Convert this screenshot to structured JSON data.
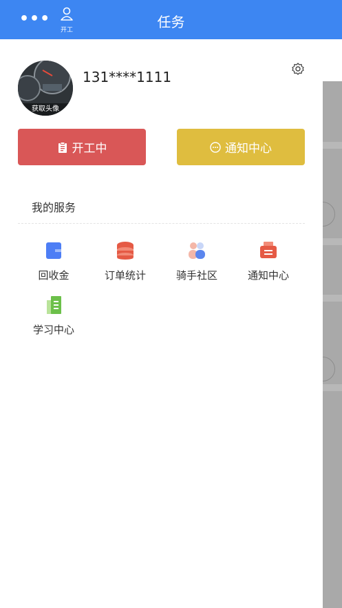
{
  "header": {
    "more_label": "•••",
    "work_label": "开工",
    "title": "任务"
  },
  "profile": {
    "avatar_caption": "获取头像",
    "phone": "131****1111"
  },
  "actions": {
    "work_button": "开工中",
    "notice_button": "通知中心"
  },
  "services": {
    "title": "我的服务",
    "items": [
      {
        "label": "回收金",
        "icon": "wallet-icon"
      },
      {
        "label": "订单统计",
        "icon": "database-icon"
      },
      {
        "label": "骑手社区",
        "icon": "community-icon"
      },
      {
        "label": "通知中心",
        "icon": "printer-icon"
      },
      {
        "label": "学习中心",
        "icon": "book-icon"
      }
    ]
  },
  "colors": {
    "header": "#3d86f2",
    "work_button": "#d95757",
    "notice_button": "#dfbd3f"
  }
}
